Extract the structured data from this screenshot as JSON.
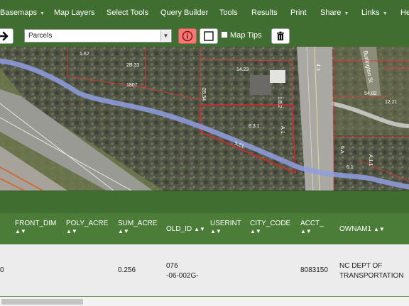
{
  "menu": {
    "basemaps": "Basemaps",
    "map_layers": "Map Layers",
    "select_tools": "Select Tools",
    "query_builder": "Query Builder",
    "tools": "Tools",
    "results": "Results",
    "print": "Print",
    "share": "Share",
    "links": "Links",
    "help": "He"
  },
  "toolbar": {
    "layer_value": "Parcels",
    "map_tips_label": "Map Tips"
  },
  "map": {
    "parcel_labels": [
      "1.62",
      "2B.33",
      "1807",
      "14.23",
      "2B.54",
      "1.B.2",
      "8.3.1",
      "5.21",
      "A.1",
      "5.A",
      "A.1.1",
      "54.82",
      "4.3",
      "6.1",
      "12.21"
    ],
    "street_label": "Burlington St",
    "colors": {
      "parcel_line": "#d83a3a",
      "selected_parcel": "#e0242d",
      "path": "#8f9fe2"
    }
  },
  "table": {
    "columns": [
      {
        "label": "FRONT_DIM"
      },
      {
        "label": "POLY_ACRE"
      },
      {
        "label": "SUM_ACRE"
      },
      {
        "label": "OLD_ID"
      },
      {
        "label": "USERINT"
      },
      {
        "label": "CITY_CODE"
      },
      {
        "label": "ACCT_"
      },
      {
        "label": "OWNAM1"
      }
    ],
    "row": {
      "front_dim": "0",
      "poly_acre": "",
      "sum_acre": "0.256",
      "old_id_line1": "076",
      "old_id_line2": "-06-002G-",
      "userint": "",
      "city_code": "",
      "acct": "8083150",
      "owner_line1": "NC DEPT OF",
      "owner_line2": "TRANSPORTATION"
    }
  },
  "theme": {
    "header_green": "#3f6e30",
    "table_header": "#4b7d38"
  }
}
